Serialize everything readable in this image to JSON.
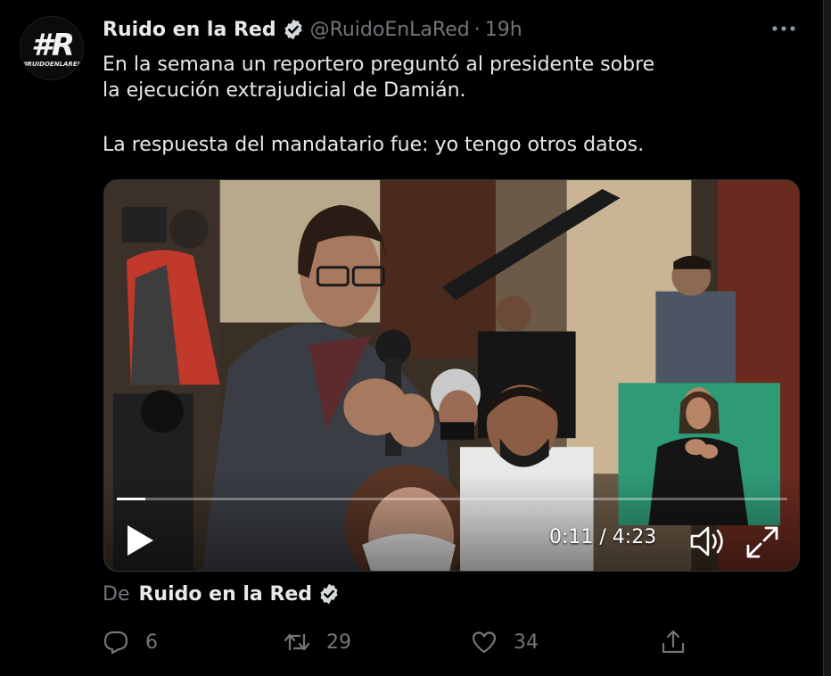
{
  "tweet": {
    "display_name": "Ruido en la Red",
    "handle": "@RuidoEnLaRed",
    "separator": "·",
    "time": "19h",
    "text_line1": "En la semana un reportero preguntó al presidente sobre",
    "text_line2": "la ejecución extrajudicial de Damián.",
    "text_line3": "La respuesta del mandatario fue: yo tengo otros datos."
  },
  "avatar": {
    "logo_main": "#R",
    "logo_sub": "#RUIDOENLARED"
  },
  "video": {
    "timecode": "0:11 / 4:23",
    "progress_fraction": 0.043
  },
  "from_line": {
    "prefix": "De",
    "name": "Ruido en la Red"
  },
  "actions": {
    "reply_count": "6",
    "retweet_count": "29",
    "like_count": "34"
  },
  "icons": {
    "verified": "verified-badge-icon",
    "more": "more-dots-icon",
    "play": "play-icon",
    "volume": "volume-icon",
    "fullscreen": "fullscreen-icon",
    "reply": "reply-icon",
    "retweet": "retweet-icon",
    "like": "like-icon",
    "share": "share-icon"
  },
  "colors": {
    "background": "#000000",
    "text_primary": "#e7e9ea",
    "text_secondary": "#71767b",
    "sign_panel": "#2f9b76"
  }
}
